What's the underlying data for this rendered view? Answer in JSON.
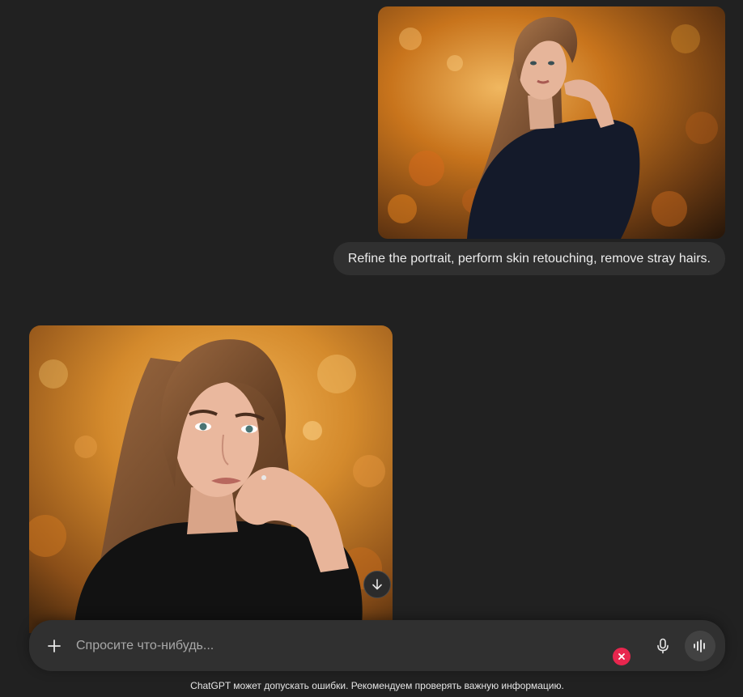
{
  "conversation": {
    "user_message": {
      "image": {
        "alt": "Portrait of a young woman with long hair in a black sweater, autumn background",
        "colors": {
          "background_warm": "#c8741c",
          "background_dark": "#3a2410",
          "sweater": "#141a2a",
          "hair": "#8a5a34",
          "skin": "#e6b59a"
        }
      },
      "text": "Refine the portrait, perform skin retouching, remove stray hairs."
    },
    "assistant_message": {
      "image": {
        "alt": "Retouched portrait of the young woman, hand raised to chin, warm autumn bokeh",
        "colors": {
          "background_warm": "#d48a2c",
          "background_dark": "#5a3412",
          "sweater": "#121212",
          "hair": "#7a4a28",
          "skin": "#eab89e"
        }
      }
    }
  },
  "composer": {
    "placeholder": "Спросите что-нибудь...",
    "add_button_icon": "plus-icon",
    "mic_icon": "microphone-icon",
    "voice_icon": "voice-waveform-icon"
  },
  "scroll_down_icon": "arrow-down-icon",
  "close_badge_icon": "close-icon",
  "accent_colors": {
    "close_badge": "#e8264e",
    "composer_bg": "#303030",
    "page_bg": "#212121"
  },
  "footer": {
    "disclaimer": "ChatGPT может допускать ошибки. Рекомендуем проверять важную информацию."
  }
}
